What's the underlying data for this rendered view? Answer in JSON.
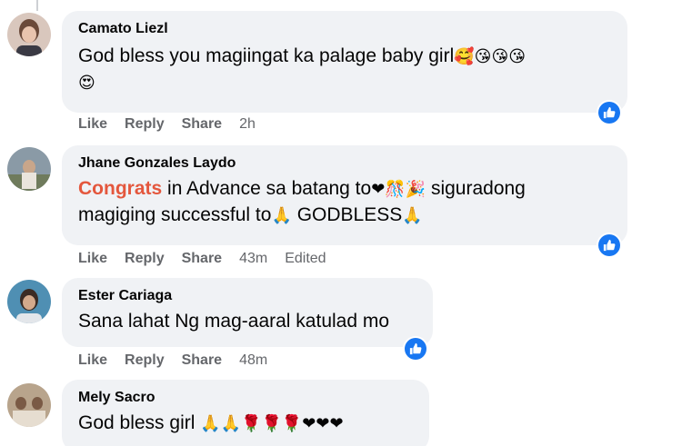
{
  "comments": [
    {
      "author": "Camato Liezl",
      "text": "God bless you magiingat ka palage baby girl",
      "emoji_line1": "🥰😘😘😘",
      "emoji_line2": "😍",
      "actions": {
        "like": "Like",
        "reply": "Reply",
        "share": "Share",
        "time": "2h"
      },
      "reaction_icon": "like-reaction-icon"
    },
    {
      "author": "Jhane Gonzales Laydo",
      "text_highlight": "Congrats",
      "text_part1": " in Advance sa batang to",
      "emoji_a": "❤🎊🎉",
      "text_part2": " siguradong",
      "text_line2": "magiging successful to",
      "emoji_b": "🙏",
      "text_line2b": " GODBLESS",
      "emoji_c": "🙏",
      "actions": {
        "like": "Like",
        "reply": "Reply",
        "share": "Share",
        "time": "43m",
        "edited": "Edited"
      },
      "reaction_icon": "like-reaction-icon"
    },
    {
      "author": "Ester Cariaga",
      "text": "Sana lahat Ng mag-aaral katulad mo",
      "actions": {
        "like": "Like",
        "reply": "Reply",
        "share": "Share",
        "time": "48m"
      },
      "reaction_icon": "like-reaction-icon"
    },
    {
      "author": "Mely Sacro",
      "text": "God bless girl ",
      "emoji": "🙏🙏🌹🌹🌹❤❤❤"
    }
  ],
  "colors": {
    "bubble": "#f0f2f5",
    "meta": "#65676b",
    "accent": "#1877f2",
    "highlight": "#e4573d"
  }
}
